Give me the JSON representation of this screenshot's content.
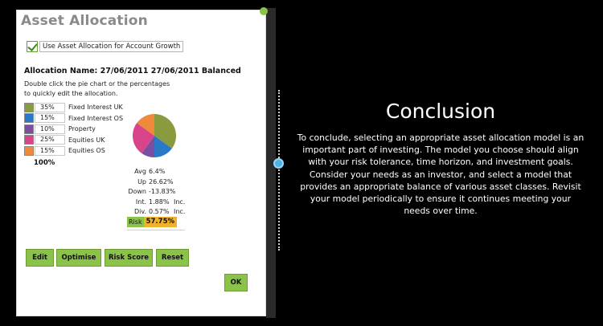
{
  "dialog": {
    "title": "Asset Allocation",
    "checkbox_label": "Use Asset Allocation for Account Growth",
    "checkbox_checked": true,
    "allocation_name": "Allocation Name: 27/06/2011 27/06/2011 Balanced",
    "instructions_line1": "Double click the pie chart or the percentages",
    "instructions_line2": "to quickly edit the allocation.",
    "allocations": [
      {
        "label": "Fixed Interest UK",
        "pct": "35%",
        "value": 35,
        "color": "#8a9a3e"
      },
      {
        "label": "Fixed Interest OS",
        "pct": "15%",
        "value": 15,
        "color": "#2a78c8"
      },
      {
        "label": "Property",
        "pct": "10%",
        "value": 10,
        "color": "#7a4fa0"
      },
      {
        "label": "Equities UK",
        "pct": "25%",
        "value": 25,
        "color": "#d8448a"
      },
      {
        "label": "Equities OS",
        "pct": "15%",
        "value": 15,
        "color": "#ee8a3a"
      }
    ],
    "total": "100%",
    "stats": [
      {
        "label": "Avg",
        "value": "6.4%",
        "suffix": ""
      },
      {
        "label": "Up",
        "value": "26.62%",
        "suffix": ""
      },
      {
        "label": "Down",
        "value": "-13.83%",
        "suffix": ""
      },
      {
        "label": "Int.",
        "value": "1.88%",
        "suffix": "Inc."
      },
      {
        "label": "Div.",
        "value": "0.57%",
        "suffix": "Inc."
      }
    ],
    "risk_label": "Risk",
    "risk_value": "57.75%",
    "buttons": {
      "edit": "Edit",
      "optimise": "Optimise",
      "risk_score": "Risk Score",
      "reset": "Reset",
      "ok": "OK"
    }
  },
  "conclusion": {
    "title": "Conclusion",
    "body": "To conclude, selecting an appropriate asset allocation model is an important part of investing. The model you choose should align with your risk tolerance, time horizon, and investment goals. Consider your needs as an investor, and select a model that provides an appropriate balance of various asset classes. Revisit your model periodically to ensure it continues meeting your needs over time."
  }
}
